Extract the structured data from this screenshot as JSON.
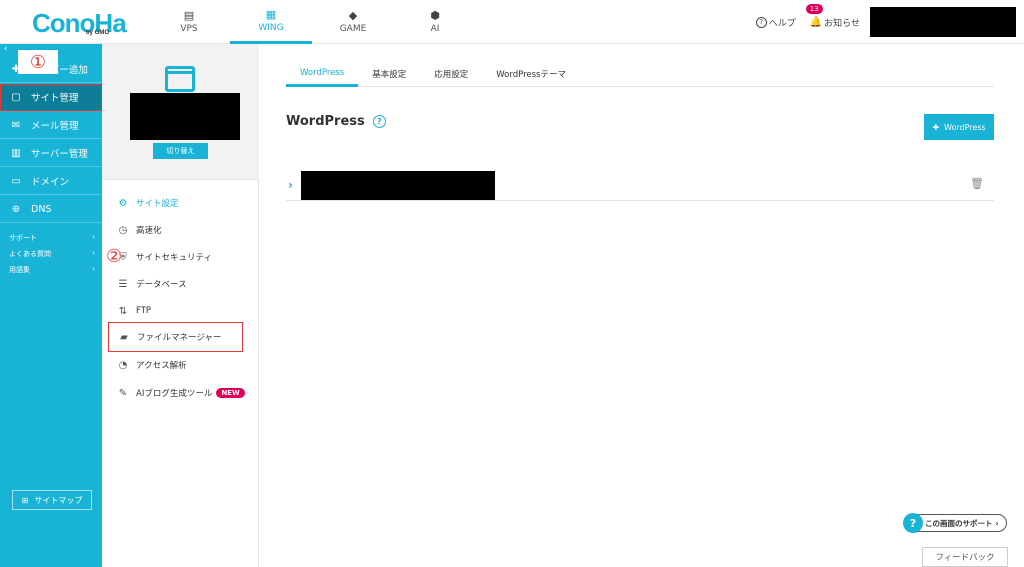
{
  "header": {
    "logo": "ConoHa",
    "logo_sub": "by GMO",
    "tabs": [
      {
        "label": "VPS",
        "icon": "server-icon"
      },
      {
        "label": "WING",
        "icon": "building-icon"
      },
      {
        "label": "GAME",
        "icon": "gamepad-icon"
      },
      {
        "label": "AI",
        "icon": "ai-icon"
      }
    ],
    "active_tab": "WING",
    "help_label": "ヘルプ",
    "notice_label": "お知らせ",
    "notice_count": "13"
  },
  "sidebar": {
    "items": [
      {
        "label": "サーバー追加",
        "icon": "plus-icon"
      },
      {
        "label": "サイト管理",
        "icon": "window-icon"
      },
      {
        "label": "メール管理",
        "icon": "mail-icon"
      },
      {
        "label": "サーバー管理",
        "icon": "server-icon"
      },
      {
        "label": "ドメイン",
        "icon": "domain-icon"
      },
      {
        "label": "DNS",
        "icon": "globe-icon"
      }
    ],
    "sub_items": [
      {
        "label": "サポート",
        "arrow": "›"
      },
      {
        "label": "よくある質問",
        "arrow": "›"
      },
      {
        "label": "用語集",
        "arrow": "›"
      }
    ],
    "sitemap_label": "サイトマップ",
    "annotation_1": "①"
  },
  "site_panel": {
    "switch_label": "切り替え",
    "menu": [
      {
        "label": "サイト設定",
        "icon": "site-settings-icon"
      },
      {
        "label": "高速化",
        "icon": "stopwatch-icon"
      },
      {
        "label": "サイトセキュリティ",
        "icon": "shield-icon"
      },
      {
        "label": "データベース",
        "icon": "database-icon"
      },
      {
        "label": "FTP",
        "icon": "transfer-arrows-icon"
      },
      {
        "label": "ファイルマネージャー",
        "icon": "folder-icon"
      },
      {
        "label": "アクセス解析",
        "icon": "pie-chart-icon"
      },
      {
        "label": "AIブログ生成ツール",
        "icon": "document-edit-icon",
        "badge": "NEW"
      }
    ],
    "annotation_2": "②"
  },
  "main": {
    "tabs": [
      "WordPress",
      "基本設定",
      "応用設定",
      "WordPressテーマ"
    ],
    "title": "WordPress",
    "add_button": "WordPress",
    "support_button": "この画面のサポート",
    "feedback_button": "フィードバック"
  },
  "colors": {
    "brand": "#19b3d6",
    "active_sidebar": "#0e7d98",
    "annotation_red": "#e53935",
    "badge_pink": "#e0005a"
  }
}
